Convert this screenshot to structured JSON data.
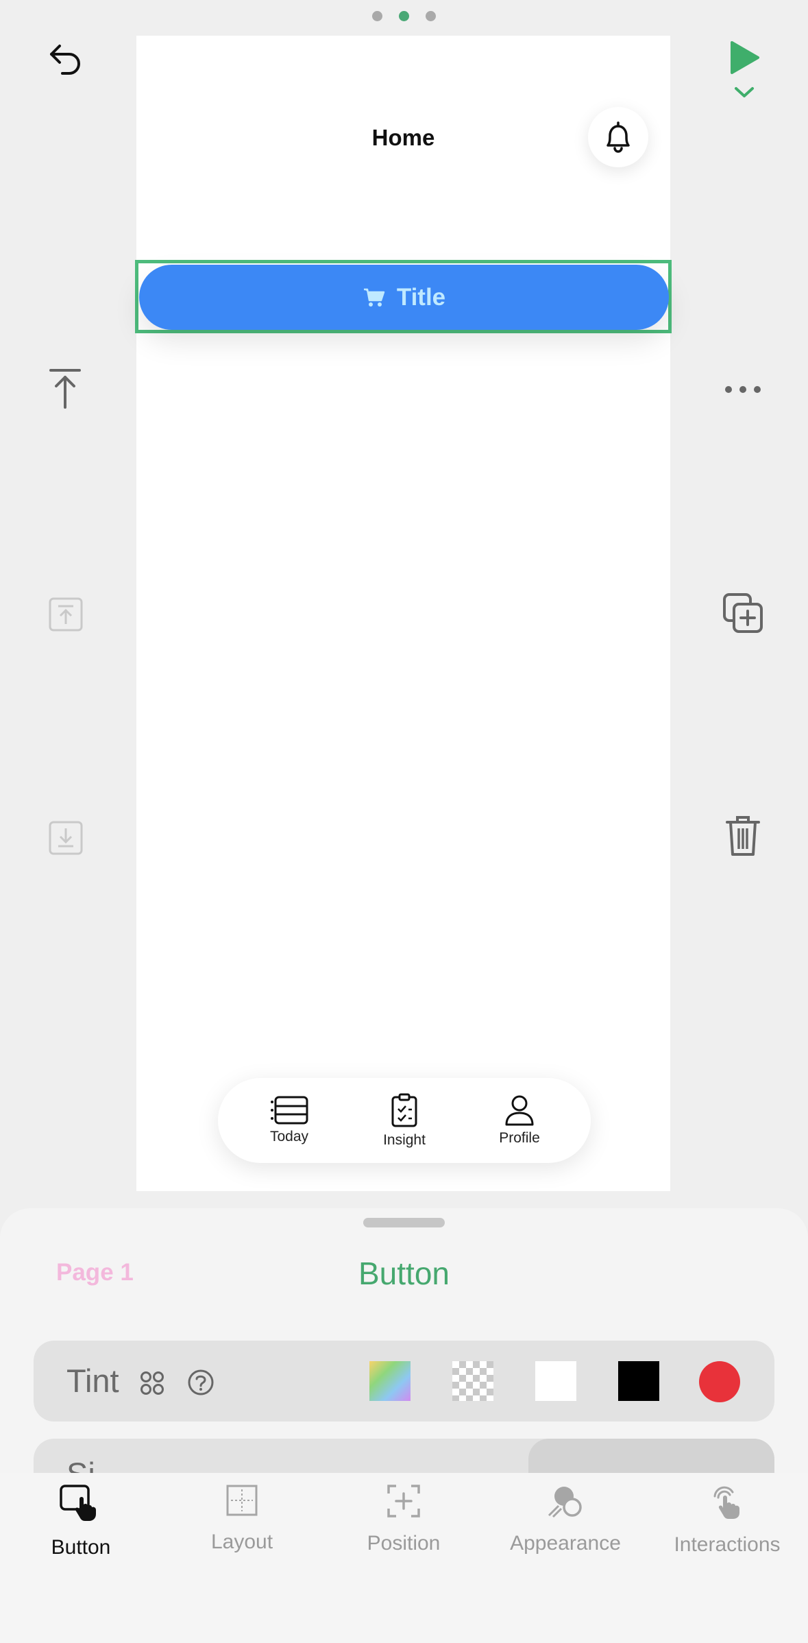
{
  "header": {
    "page_dots": 3,
    "active_dot": 1
  },
  "canvas": {
    "title": "Home",
    "button": {
      "label": "Title",
      "color": "#3c88f5",
      "label_color": "#bfe9ff"
    },
    "tab_bar": [
      {
        "label": "Today",
        "icon": "today-list-icon"
      },
      {
        "label": "Insight",
        "icon": "clipboard-icon"
      },
      {
        "label": "Profile",
        "icon": "person-icon"
      }
    ]
  },
  "panel": {
    "breadcrumb": "Page 1",
    "title": "Button",
    "tint": {
      "label": "Tint",
      "swatches": [
        "gradient",
        "transparent",
        "#ffffff",
        "#000000",
        "#e8323a"
      ]
    },
    "next_row_label_partial": "Si"
  },
  "toolbar": {
    "items": [
      {
        "label": "Button",
        "icon": "button-tap-icon",
        "active": true
      },
      {
        "label": "Layout",
        "icon": "layout-icon",
        "active": false
      },
      {
        "label": "Position",
        "icon": "position-icon",
        "active": false
      },
      {
        "label": "Appearance",
        "icon": "appearance-icon",
        "active": false
      },
      {
        "label": "Interactions",
        "icon": "interactions-icon",
        "active": false
      }
    ]
  },
  "colors": {
    "accent": "#46a86f",
    "selection": "#4dbb7c"
  }
}
